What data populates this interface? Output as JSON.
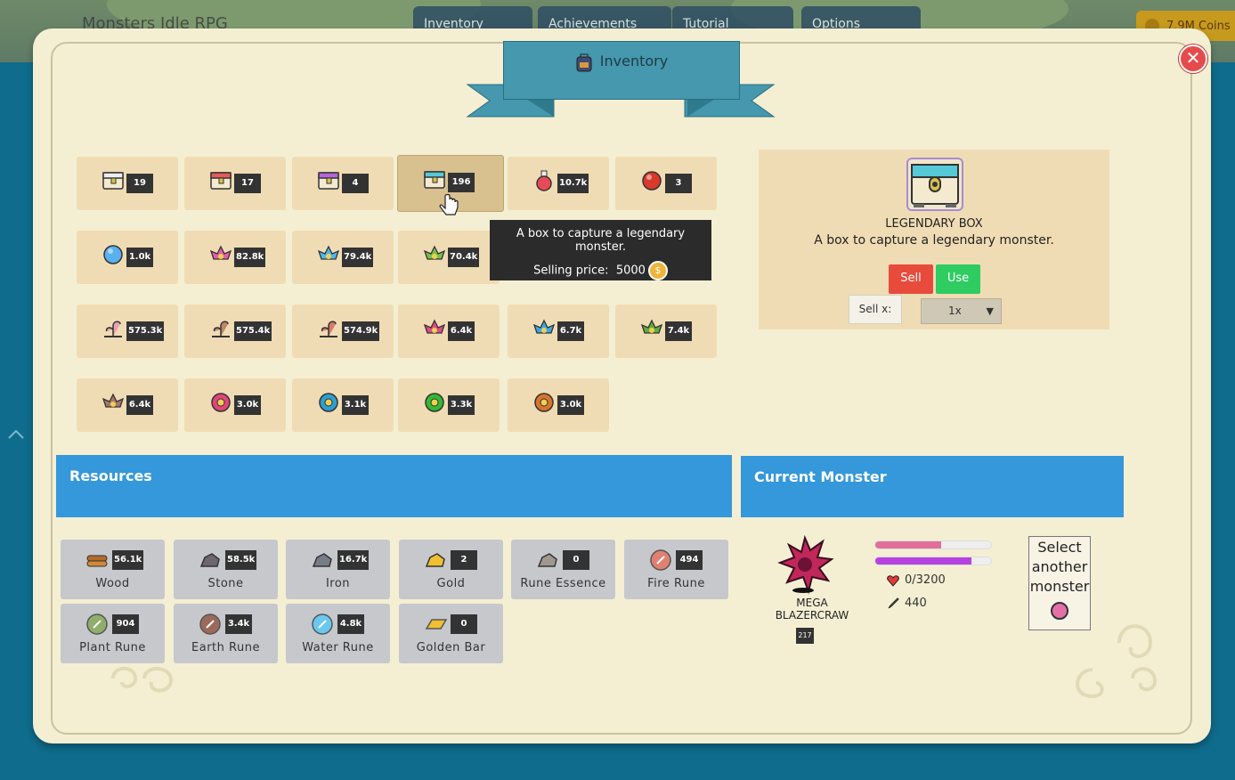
{
  "header": {
    "game_title": "Monsters Idle RPG",
    "buttons": [
      {
        "label": "Inventory",
        "icon": "backpack-icon"
      },
      {
        "label": "Achievements",
        "icon": "trophy-icon"
      },
      {
        "label": "Tutorial",
        "icon": "question-icon"
      },
      {
        "label": "Options",
        "icon": "gear-icon"
      }
    ],
    "coins": "7.9M Coins"
  },
  "modal": {
    "title": "Inventory",
    "close_label": "✕"
  },
  "inventory": {
    "items": [
      {
        "icon": "white-box-icon",
        "count": "19"
      },
      {
        "icon": "red-box-icon",
        "count": "17"
      },
      {
        "icon": "purple-box-icon",
        "count": "4"
      },
      {
        "icon": "legendary-box-icon",
        "count": "196",
        "selected": true
      },
      {
        "icon": "red-potion-icon",
        "count": "10.7k"
      },
      {
        "icon": "red-orb-icon",
        "count": "3"
      },
      {
        "icon": "blue-orb-icon",
        "count": "1.0k"
      },
      {
        "icon": "pink-lotus-icon",
        "count": "82.8k"
      },
      {
        "icon": "blue-lotus-icon",
        "count": "79.4k"
      },
      {
        "icon": "green-lotus-icon",
        "count": "70.4k"
      },
      {
        "icon": "hidden-item-icon",
        "count": ""
      },
      {
        "icon": "hidden-item-icon",
        "count": ""
      },
      {
        "icon": "sprout-pink-icon",
        "count": "575.3k"
      },
      {
        "icon": "sprout-brown-icon",
        "count": "575.4k"
      },
      {
        "icon": "sprout-red-icon",
        "count": "574.9k"
      },
      {
        "icon": "big-pink-lotus-icon",
        "count": "6.4k"
      },
      {
        "icon": "big-blue-lotus-icon",
        "count": "6.7k"
      },
      {
        "icon": "big-green-lotus-icon",
        "count": "7.4k"
      },
      {
        "icon": "brown-lotus-icon",
        "count": "6.4k"
      },
      {
        "icon": "pink-flower-icon",
        "count": "3.0k"
      },
      {
        "icon": "blue-flower-icon",
        "count": "3.1k"
      },
      {
        "icon": "green-flower-icon",
        "count": "3.3k"
      },
      {
        "icon": "orange-flower-icon",
        "count": "3.0k"
      }
    ],
    "tooltip": {
      "description": "A box to capture a legendary monster.",
      "price_label": "Selling price:",
      "price_value": "5000",
      "coin_symbol": "$"
    }
  },
  "detail": {
    "name": "LEGENDARY BOX",
    "description": "A box to capture a legendary monster.",
    "sell_label": "Sell",
    "use_label": "Use",
    "sellx_label": "Sell x:",
    "quantity": "1x"
  },
  "resources": {
    "title": "Resources",
    "items": [
      {
        "label": "Wood",
        "count": "56.1k",
        "icon": "wood-icon"
      },
      {
        "label": "Stone",
        "count": "58.5k",
        "icon": "stone-icon"
      },
      {
        "label": "Iron",
        "count": "16.7k",
        "icon": "iron-icon"
      },
      {
        "label": "Gold",
        "count": "2",
        "icon": "gold-icon"
      },
      {
        "label": "Rune Essence",
        "count": "0",
        "icon": "rune-essence-icon"
      },
      {
        "label": "Fire Rune",
        "count": "494",
        "icon": "fire-rune-icon"
      },
      {
        "label": "Plant Rune",
        "count": "904",
        "icon": "plant-rune-icon"
      },
      {
        "label": "Earth Rune",
        "count": "3.4k",
        "icon": "earth-rune-icon"
      },
      {
        "label": "Water Rune",
        "count": "4.8k",
        "icon": "water-rune-icon"
      },
      {
        "label": "Golden Bar",
        "count": "0",
        "icon": "golden-bar-icon"
      }
    ]
  },
  "current_monster": {
    "title": "Current Monster",
    "name_line1": "MEGA",
    "name_line2": "BLAZERCRAW",
    "level": "217",
    "hp_text": "0/3200",
    "attack_text": "440",
    "hp_bar_fraction": 0.57,
    "xp_bar_fraction": 0.83,
    "select_label": "Select another monster"
  },
  "colors": {
    "accent_blue": "#3498db",
    "sell_red": "#e84a3c",
    "use_green": "#2ecc61",
    "panel_bg": "#f4efd3",
    "slot_bg": "#f0dcb4",
    "hp_bar": "#e0709a",
    "xp_bar": "#b543e0"
  }
}
